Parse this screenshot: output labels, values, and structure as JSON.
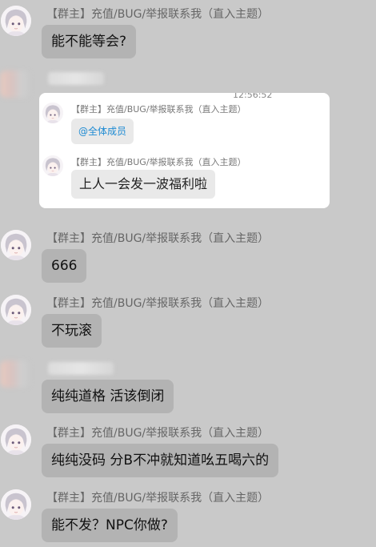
{
  "sender_name": "【群主】充值/BUG/举报联系我（直入主题）",
  "messages": [
    {
      "text": "能不能等会?"
    },
    {
      "text": "666"
    },
    {
      "text": "不玩滚"
    },
    {
      "text": "纯纯道格 活该倒闭"
    },
    {
      "text": "纯纯没码 分B不冲就知道吆五喝六的"
    },
    {
      "text": "能不发？NPC你做?"
    }
  ],
  "forwarded_card": {
    "time": "12:56:52",
    "items": [
      {
        "text": "@全体成员"
      },
      {
        "text": "上人一会发一波福利啦"
      }
    ]
  },
  "colors": {
    "background": "#c9c9c9",
    "bubble": "#b3b3b3",
    "card": "#ffffff",
    "mention": "#1e8bd3"
  }
}
